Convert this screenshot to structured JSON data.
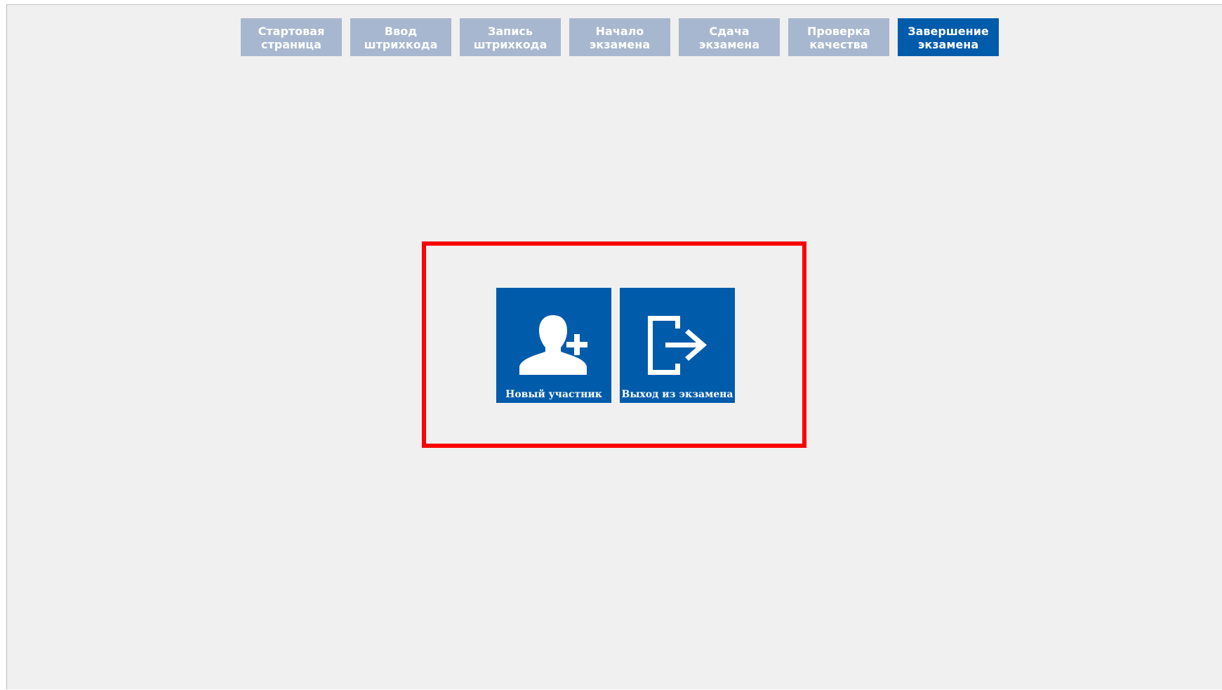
{
  "steps": [
    {
      "line1": "Стартовая",
      "line2": "страница",
      "active": false
    },
    {
      "line1": "Ввод",
      "line2": "штрихкода",
      "active": false
    },
    {
      "line1": "Запись",
      "line2": "штрихкода",
      "active": false
    },
    {
      "line1": "Начало",
      "line2": "экзамена",
      "active": false
    },
    {
      "line1": "Сдача",
      "line2": "экзамена",
      "active": false
    },
    {
      "line1": "Проверка",
      "line2": "качества",
      "active": false
    },
    {
      "line1": "Завершение",
      "line2": "экзамена",
      "active": true
    }
  ],
  "actions": {
    "new_participant": {
      "label": "Новый участник",
      "icon": "add-user-icon"
    },
    "exit_exam": {
      "label": "Выход из экзамена",
      "icon": "exit-icon"
    }
  },
  "colors": {
    "step_inactive": "#a7b7cf",
    "step_active": "#005bab",
    "tile": "#005bab",
    "highlight": "#ff0000",
    "background": "#f0f0f0"
  }
}
